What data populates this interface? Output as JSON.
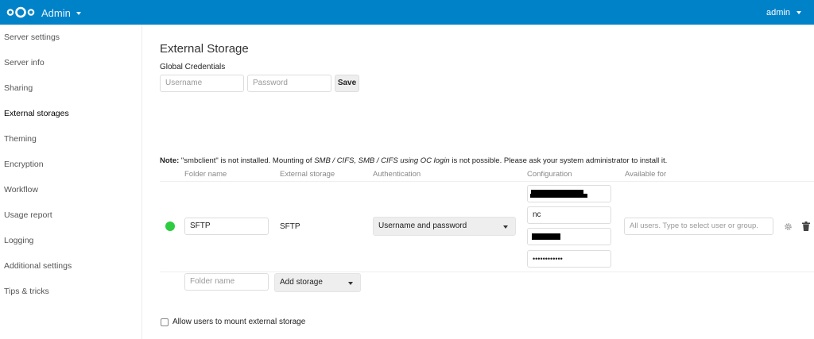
{
  "header": {
    "app_name": "Admin",
    "user": "admin",
    "accent_color": "#0082c9",
    "logo_icon": "nextcloud-logo-icon"
  },
  "sidebar": {
    "items": [
      {
        "label": "Server settings"
      },
      {
        "label": "Server info"
      },
      {
        "label": "Sharing"
      },
      {
        "label": "External storages",
        "active": true
      },
      {
        "label": "Theming"
      },
      {
        "label": "Encryption"
      },
      {
        "label": "Workflow"
      },
      {
        "label": "Usage report"
      },
      {
        "label": "Logging"
      },
      {
        "label": "Additional settings"
      },
      {
        "label": "Tips & tricks"
      }
    ]
  },
  "main": {
    "title": "External Storage",
    "global_credentials": {
      "heading": "Global Credentials",
      "username_placeholder": "Username",
      "password_placeholder": "Password",
      "save_label": "Save"
    },
    "note": {
      "bold": "Note:",
      "text1": " \"smbclient\" is not installed. Mounting of ",
      "italic": "SMB / CIFS, SMB / CIFS using OC login",
      "text2": " is not possible. Please ask your system administrator to install it."
    },
    "table": {
      "headers": [
        "Folder name",
        "External storage",
        "Authentication",
        "Configuration",
        "Available for"
      ],
      "row": {
        "status_color": "#2ecc40",
        "folder_name": "SFTP",
        "external_storage": "SFTP",
        "authentication": "Username and password",
        "config_root": "nc",
        "config_password": "••••••••••••",
        "available_for_placeholder": "All users. Type to select user or group."
      },
      "new_row": {
        "folder_name_placeholder": "Folder name",
        "add_storage_label": "Add storage"
      }
    },
    "allow_users_label": "Allow users to mount external storage"
  }
}
